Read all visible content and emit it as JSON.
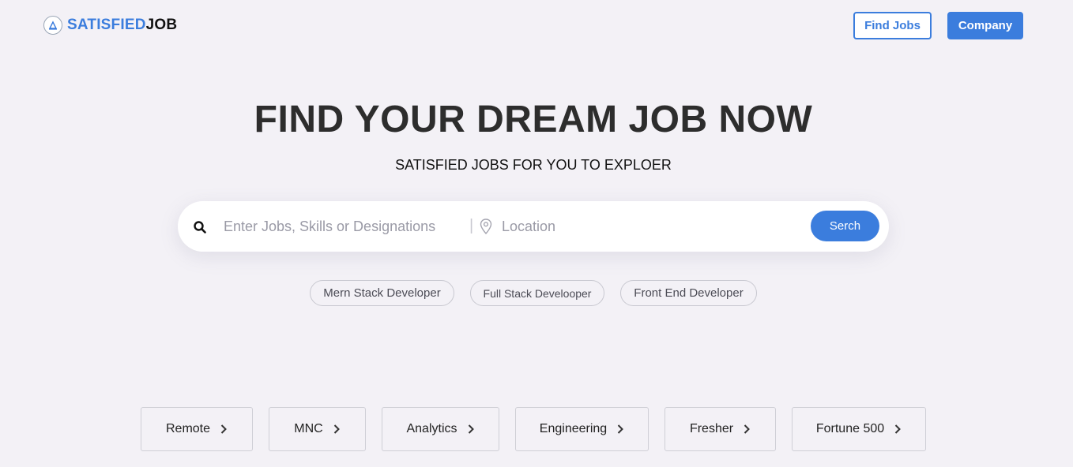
{
  "brand": {
    "name_part1": "SATISFIED",
    "name_part2": "JOB",
    "accent_color": "#3b7ddd"
  },
  "nav": {
    "find_jobs": "Find Jobs",
    "company": "Company"
  },
  "hero": {
    "title": "FIND YOUR DREAM JOB NOW",
    "subtitle": "SATISFIED JOBS FOR YOU TO EXPLOER"
  },
  "search": {
    "keyword_placeholder": "Enter Jobs, Skills or Designations",
    "divider": "|",
    "location_placeholder": "Location",
    "button_label": "Serch",
    "icons": {
      "search": "search-icon",
      "location": "map-pin-icon"
    }
  },
  "suggestions": [
    "Mern Stack Developer",
    "Full Stack Develooper",
    "Front End Developer"
  ],
  "categories": [
    "Remote",
    "MNC",
    "Analytics",
    "Engineering",
    "Fresher",
    "Fortune 500"
  ]
}
